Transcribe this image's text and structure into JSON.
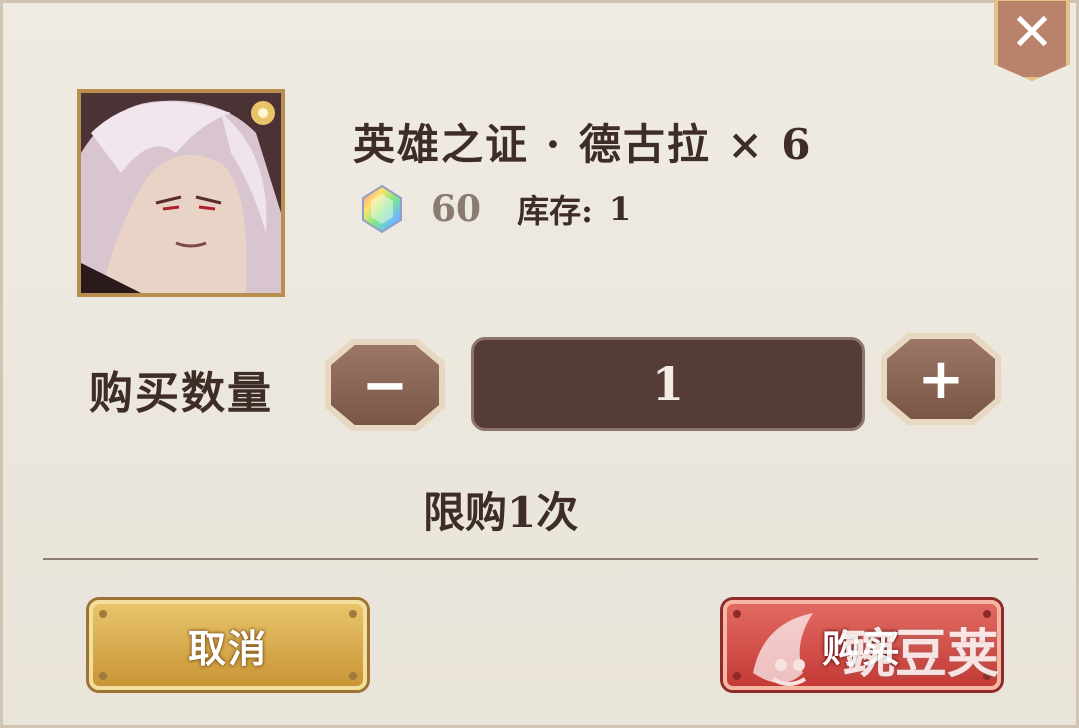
{
  "item": {
    "title": "英雄之证 · 德古拉 × 6",
    "price": "60",
    "stock_label": "库存:",
    "stock_value": "1"
  },
  "purchase": {
    "quantity_label": "购买数量",
    "quantity_value": "1",
    "minus_label": "−",
    "plus_label": "+",
    "limit_text": "限购1次"
  },
  "buttons": {
    "cancel_label": "取消",
    "buy_label": "购买",
    "close_label": "✕"
  },
  "watermark": {
    "text": "豌豆荚"
  },
  "colors": {
    "panel_bg": "#ece8df",
    "text_dark": "#3e2d27",
    "qty_box": "#553c36",
    "cancel": "#d8aa4c",
    "buy": "#d1504a"
  },
  "icons": {
    "currency": "rainbow-gem-icon",
    "close": "close-icon"
  }
}
